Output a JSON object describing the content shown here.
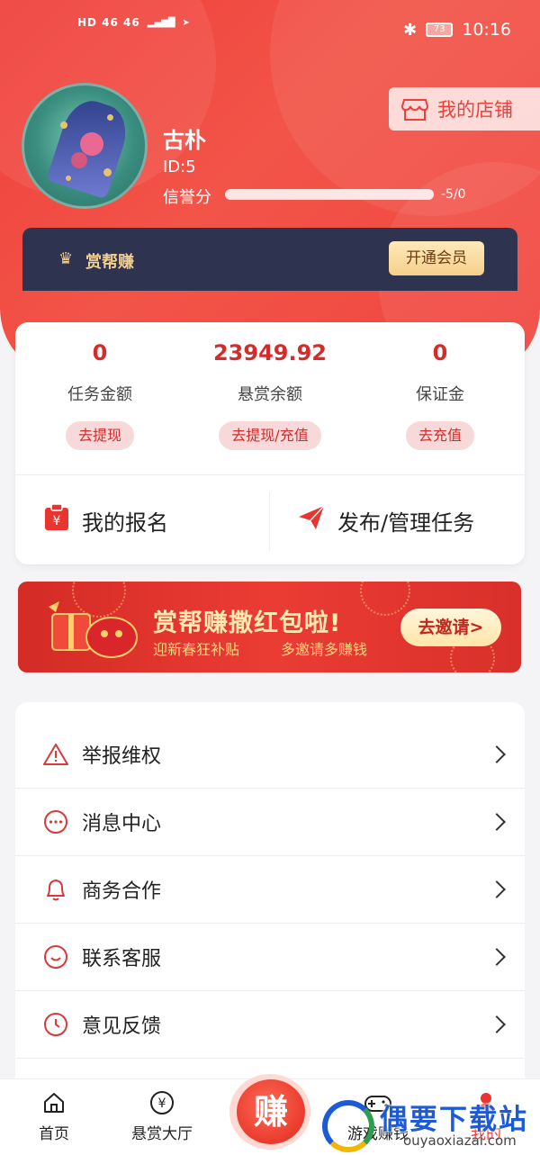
{
  "status_bar": {
    "network_left": "HD 46 46",
    "battery": "73",
    "time": "10:16"
  },
  "profile": {
    "name": "古朴",
    "id_text": "ID:5",
    "credit_label": "信誉分",
    "credit_value": "-5/0",
    "credit_progress": 0
  },
  "shop_button": {
    "label": "我的店铺"
  },
  "vip": {
    "brand": "赏帮赚",
    "open_button": "开通会员"
  },
  "balances": [
    {
      "value": "0",
      "label": "任务金额",
      "action": "去提现"
    },
    {
      "value": "23949.92",
      "label": "悬赏余额",
      "action": "去提现/充值"
    },
    {
      "value": "0",
      "label": "保证金",
      "action": "去充值"
    }
  ],
  "actions": {
    "my_signup": "我的报名",
    "publish_manage": "发布/管理任务"
  },
  "banner": {
    "title": "赏帮赚撒红包啦!",
    "subtitle_1": "迎新春狂补贴",
    "subtitle_2": "多邀请多赚钱",
    "invite_button": "去邀请>"
  },
  "menu": [
    {
      "label": "举报维权",
      "icon": "warning-icon"
    },
    {
      "label": "消息中心",
      "icon": "chat-icon"
    },
    {
      "label": "商务合作",
      "icon": "bell-icon"
    },
    {
      "label": "联系客服",
      "icon": "smile-icon"
    },
    {
      "label": "意见反馈",
      "icon": "clock-icon"
    }
  ],
  "tabbar": {
    "home": "首页",
    "bounty_hall": "悬赏大厅",
    "earn": "赚",
    "games": "游戏赚钱",
    "mine": "我的"
  },
  "watermark": {
    "text": "偶要下载站",
    "url": "ouyaoxiazai.com"
  },
  "colors": {
    "brand_red": "#ef3f3a",
    "vip_dark": "#2e3350",
    "gold": "#f3cf8f",
    "value_red": "#d62b2b"
  }
}
